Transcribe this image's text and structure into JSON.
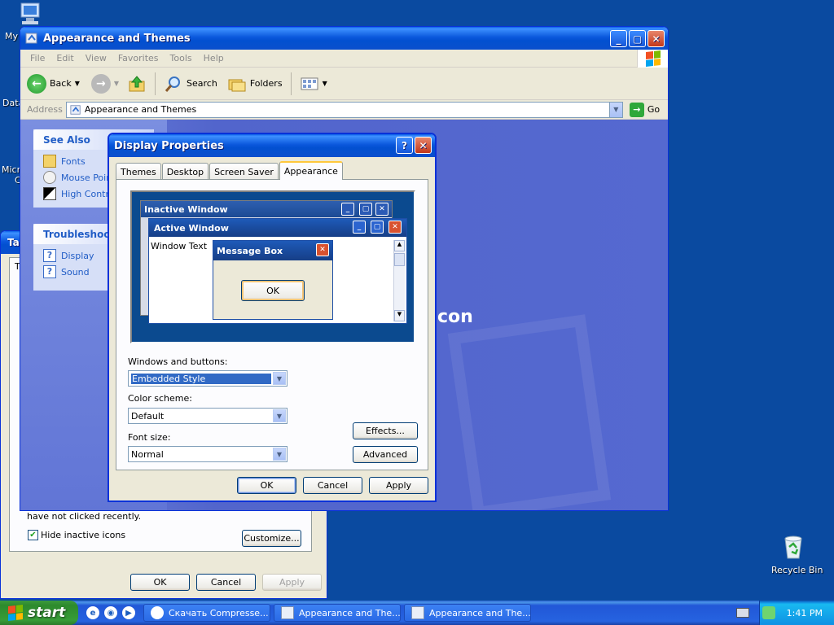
{
  "desktop": {
    "icons": [
      {
        "label": "My"
      },
      {
        "label": "Data"
      },
      {
        "label": "Micro"
      },
      {
        "label": "C"
      },
      {
        "label": "Recycle Bin"
      }
    ]
  },
  "explorer": {
    "title": "Appearance and Themes",
    "menu": [
      "File",
      "Edit",
      "View",
      "Favorites",
      "Tools",
      "Help"
    ],
    "toolbar": {
      "back": "Back",
      "search": "Search",
      "folders": "Folders"
    },
    "address": {
      "label": "Address",
      "value": "Appearance and Themes",
      "go": "Go"
    },
    "see_also": {
      "title": "See Also",
      "items": [
        "Fonts",
        "Mouse Pointers",
        "High Contrast"
      ]
    },
    "troubleshooters": {
      "title": "Troubleshooters",
      "items": [
        "Display",
        "Sound"
      ]
    },
    "watermark_text": "con"
  },
  "taskbar_properties": {
    "title": "Ta",
    "frame_letter": "T",
    "text": "have not clicked recently.",
    "hide_inactive_label": "Hide inactive icons",
    "hide_inactive_checked": true,
    "customize": "Customize...",
    "ok": "OK",
    "cancel": "Cancel",
    "apply": "Apply"
  },
  "display_properties": {
    "title": "Display Properties",
    "tabs": [
      "Themes",
      "Desktop",
      "Screen Saver",
      "Appearance"
    ],
    "active_tab": "Appearance",
    "preview": {
      "inactive_title": "Inactive Window",
      "active_title": "Active Window",
      "window_text": "Window Text",
      "message_title": "Message Box",
      "message_ok": "OK"
    },
    "windows_buttons_label": "Windows and buttons:",
    "windows_buttons_value": "Embedded Style",
    "color_scheme_label": "Color scheme:",
    "color_scheme_value": "Default",
    "font_size_label": "Font size:",
    "font_size_value": "Normal",
    "effects": "Effects...",
    "advanced": "Advanced",
    "ok": "OK",
    "cancel": "Cancel",
    "apply": "Apply"
  },
  "taskbar": {
    "start": "start",
    "tasks": [
      "Скачать Compresse...",
      "Appearance and The...",
      "Appearance and The..."
    ],
    "clock": "1:41 PM"
  },
  "colors": {
    "desktop": "#0a4aa0",
    "title_blue": "#0b58dc",
    "link_blue": "#215dc6",
    "start_green": "#379d37"
  }
}
